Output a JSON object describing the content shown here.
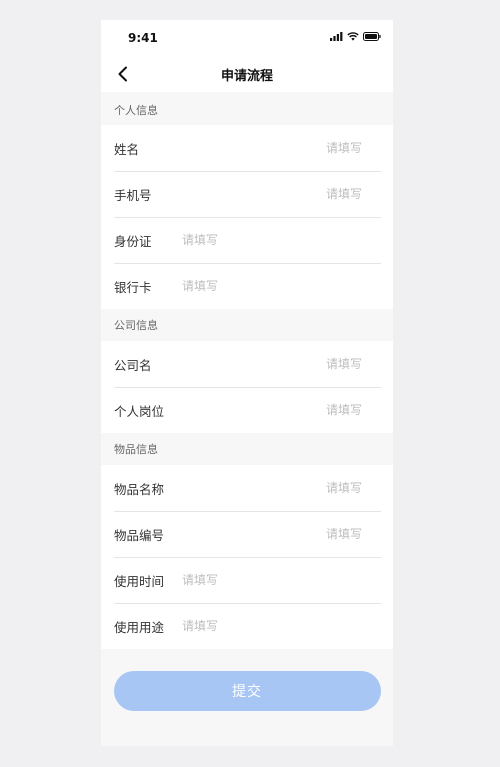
{
  "status_bar": {
    "time": "9:41",
    "icons": [
      "signal-icon",
      "wifi-icon",
      "battery-icon"
    ]
  },
  "nav": {
    "title": "申请流程",
    "back_icon": "chevron-left-icon"
  },
  "sections": {
    "personal": {
      "title": "个人信息",
      "fields": {
        "name": {
          "label": "姓名",
          "placeholder": "请填写",
          "value": ""
        },
        "phone": {
          "label": "手机号",
          "placeholder": "请填写",
          "value": ""
        },
        "id_card": {
          "label": "身份证",
          "placeholder": "请填写",
          "value": ""
        },
        "bank_card": {
          "label": "银行卡",
          "placeholder": "请填写",
          "value": ""
        }
      }
    },
    "company": {
      "title": "公司信息",
      "fields": {
        "company_name": {
          "label": "公司名",
          "placeholder": "请填写",
          "value": ""
        },
        "position": {
          "label": "个人岗位",
          "placeholder": "请填写",
          "value": ""
        }
      }
    },
    "item": {
      "title": "物品信息",
      "fields": {
        "item_name": {
          "label": "物品名称",
          "placeholder": "请填写",
          "value": ""
        },
        "item_number": {
          "label": "物品编号",
          "placeholder": "请填写",
          "value": ""
        },
        "use_time": {
          "label": "使用时间",
          "placeholder": "请填写",
          "value": ""
        },
        "use_purpose": {
          "label": "使用用途",
          "placeholder": "请填写",
          "value": ""
        }
      }
    }
  },
  "submit": {
    "label": "提交"
  },
  "colors": {
    "submit_bg": "#a8c6f4",
    "placeholder": "#bdbdbd",
    "page_bg": "#f0f0f2"
  }
}
